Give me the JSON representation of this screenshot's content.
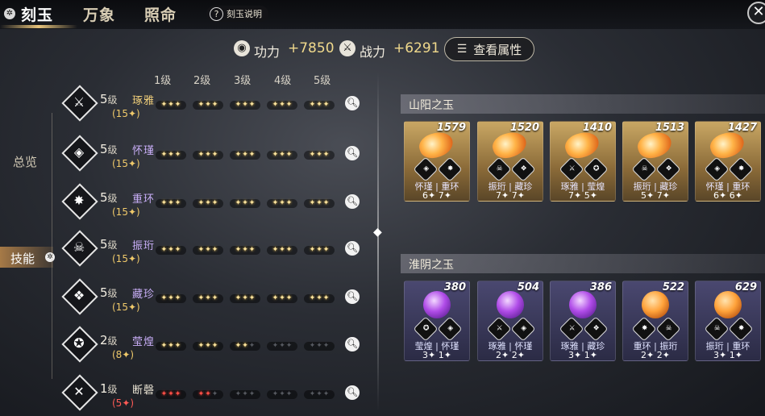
{
  "tabs": [
    {
      "label": "刻玉",
      "active": true
    },
    {
      "label": "万象",
      "active": false
    },
    {
      "label": "照命",
      "active": false
    }
  ],
  "help_label": "刻玉说明",
  "stats": {
    "power_label": "功力",
    "power_value": "+7850",
    "combat_label": "战力",
    "combat_value": "+6291",
    "attr_button": "查看属性"
  },
  "side_nav": {
    "overview": "总览",
    "skills": "技能"
  },
  "levels_header": [
    "1级",
    "2级",
    "3级",
    "4级",
    "5级"
  ],
  "skills": [
    {
      "icon": "sword-icon",
      "level": "5",
      "lv_suffix": "级",
      "points": "(15✦)",
      "name": "琢雅",
      "name_color": "#f1cf7a",
      "filled": [
        3,
        3,
        3,
        3,
        3
      ],
      "red": false
    },
    {
      "icon": "shield-mask-icon",
      "level": "5",
      "lv_suffix": "级",
      "points": "(15✦)",
      "name": "怀瑾",
      "name_color": "#c8aef7",
      "filled": [
        3,
        3,
        3,
        3,
        3
      ],
      "red": false
    },
    {
      "icon": "spear-icon",
      "level": "5",
      "lv_suffix": "级",
      "points": "(15✦)",
      "name": "重环",
      "name_color": "#c8aef7",
      "filled": [
        3,
        3,
        3,
        3,
        3
      ],
      "red": false
    },
    {
      "icon": "skull-icon",
      "level": "5",
      "lv_suffix": "级",
      "points": "(15✦)",
      "name": "振珩",
      "name_color": "#c8aef7",
      "filled": [
        3,
        3,
        3,
        3,
        3
      ],
      "red": false
    },
    {
      "icon": "flame-bird-icon",
      "level": "5",
      "lv_suffix": "级",
      "points": "(15✦)",
      "name": "藏珍",
      "name_color": "#c8aef7",
      "filled": [
        3,
        3,
        3,
        3,
        3
      ],
      "red": false
    },
    {
      "icon": "guard-icon",
      "level": "2",
      "lv_suffix": "级",
      "points": "(8✦)",
      "name": "莹煌",
      "name_color": "#c8aef7",
      "filled": [
        3,
        3,
        2,
        0,
        0
      ],
      "red": false
    },
    {
      "icon": "crossed-blades-icon",
      "level": "1",
      "lv_suffix": "级",
      "points": "(5✦)",
      "name": "断磬",
      "name_color": "#e8e2d2",
      "filled": [
        3,
        2,
        0,
        0,
        0
      ],
      "red": true
    }
  ],
  "sections": [
    {
      "title": "山阳之玉",
      "cards": [
        {
          "value": "1579",
          "gem": "orange",
          "icons": [
            "shield-mask-icon",
            "spear-icon"
          ],
          "names": "怀瑾 | 重环",
          "levels": "6✦  7✦"
        },
        {
          "value": "1520",
          "gem": "orange",
          "icons": [
            "skull-icon",
            "flame-bird-icon"
          ],
          "names": "振珩 | 藏珍",
          "levels": "7✦  7✦"
        },
        {
          "value": "1410",
          "gem": "orange",
          "icons": [
            "sword-icon",
            "guard-icon"
          ],
          "names": "琢雅 | 莹煌",
          "levels": "7✦  5✦"
        },
        {
          "value": "1513",
          "gem": "orange",
          "icons": [
            "skull-icon",
            "flame-bird-icon"
          ],
          "names": "振珩 | 藏珍",
          "levels": "5✦  7✦"
        },
        {
          "value": "1427",
          "gem": "orange",
          "icons": [
            "shield-mask-icon",
            "spear-icon"
          ],
          "names": "怀瑾 | 重环",
          "levels": "6✦  6✦"
        }
      ]
    },
    {
      "title": "淮阴之玉",
      "cards": [
        {
          "value": "380",
          "gem": "purple",
          "icons": [
            "guard-icon",
            "shield-mask-icon"
          ],
          "names": "莹煌 | 怀瑾",
          "levels": "3✦  1✦"
        },
        {
          "value": "504",
          "gem": "purple",
          "icons": [
            "sword-icon",
            "shield-mask-icon"
          ],
          "names": "琢雅 | 怀瑾",
          "levels": "2✦  2✦"
        },
        {
          "value": "386",
          "gem": "purple",
          "icons": [
            "sword-icon",
            "flame-bird-icon"
          ],
          "names": "琢雅 | 藏珍",
          "levels": "3✦  1✦"
        },
        {
          "value": "522",
          "gem": "amber",
          "icons": [
            "spear-icon",
            "skull-icon"
          ],
          "names": "重环 | 振珩",
          "levels": "2✦  2✦"
        },
        {
          "value": "629",
          "gem": "amber",
          "icons": [
            "skull-icon",
            "spear-icon"
          ],
          "names": "振珩 | 重环",
          "levels": "3✦  1✦"
        }
      ]
    }
  ]
}
